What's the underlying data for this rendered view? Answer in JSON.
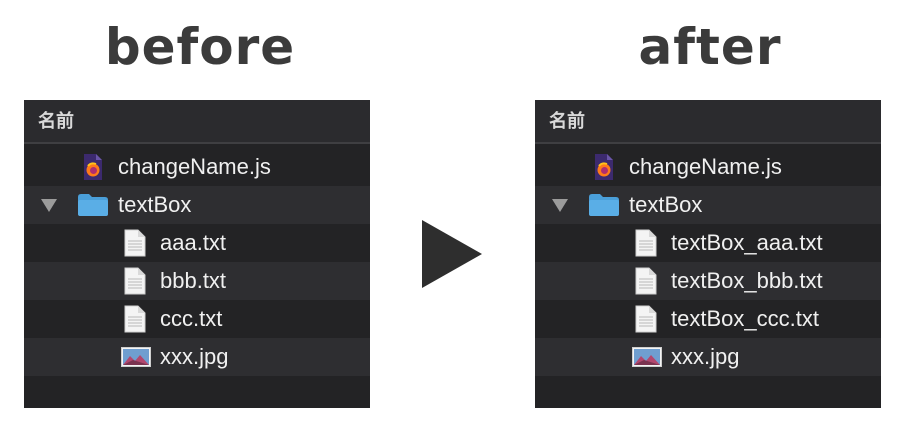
{
  "titles": {
    "before": "before",
    "after": "after"
  },
  "column_header": "名前",
  "before": {
    "js_file": "changeName.js",
    "folder": "textBox",
    "files": [
      "aaa.txt",
      "bbb.txt",
      "ccc.txt"
    ],
    "image_file": "xxx.jpg"
  },
  "after": {
    "js_file": "changeName.js",
    "folder": "textBox",
    "files": [
      "textBox_aaa.txt",
      "textBox_bbb.txt",
      "textBox_ccc.txt"
    ],
    "image_file": "xxx.jpg"
  },
  "icons": {
    "js": "firefox-js-file-icon",
    "folder": "folder-icon",
    "text": "text-file-icon",
    "image": "image-file-icon",
    "disclosure": "disclosure-triangle-icon",
    "arrow": "play-arrow-icon"
  },
  "colors": {
    "panel_bg": "#232325",
    "row_alt": "#2e2e31",
    "folder": "#5aaee6",
    "text": "#f0f0f0"
  }
}
